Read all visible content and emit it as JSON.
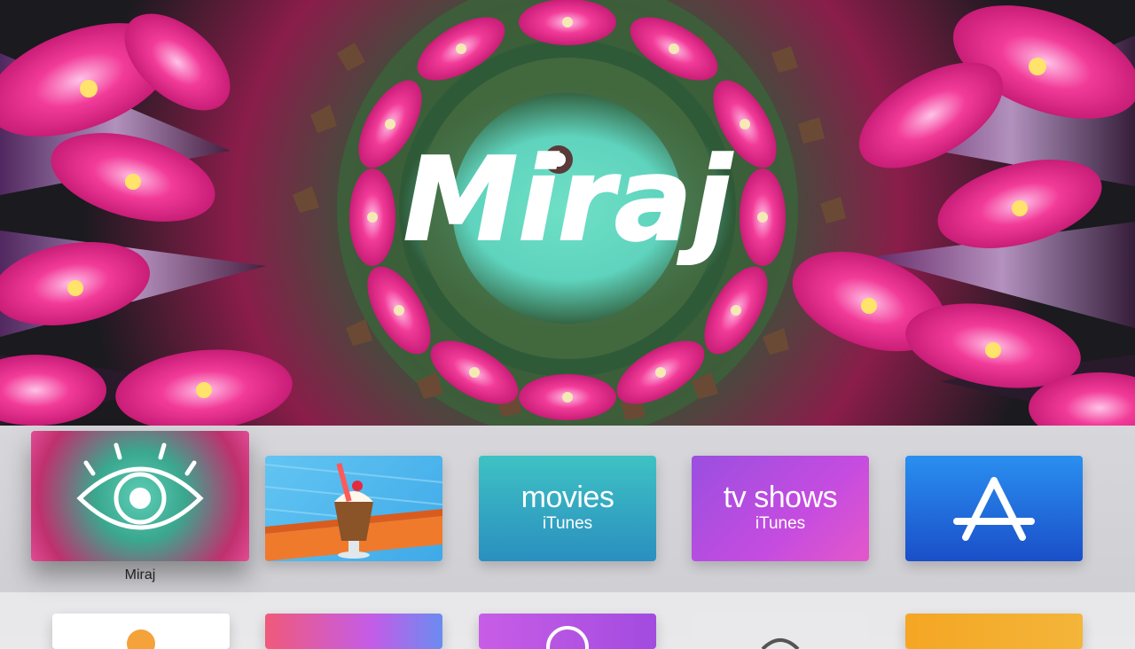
{
  "hero": {
    "title": "Miraj",
    "colors": {
      "flower": "#ee2f8f",
      "teal": "#63d6bf",
      "cactus": "#3b5a36"
    }
  },
  "top_shelf": {
    "apps": [
      {
        "name": "Miraj",
        "focused": true,
        "icon": "eye-icon"
      },
      {
        "name": "",
        "icon": "milkshake-icon"
      },
      {
        "name": "",
        "line1": "movies",
        "line2": "iTunes",
        "icon": "itunes-movies"
      },
      {
        "name": "",
        "line1": "tv shows",
        "line2": "iTunes",
        "icon": "itunes-tv"
      },
      {
        "name": "",
        "icon": "app-store-icon"
      }
    ]
  },
  "bottom_row": {
    "apps": [
      "white-app",
      "pink-app",
      "purple-app",
      "grey-app",
      "orange-app"
    ]
  }
}
